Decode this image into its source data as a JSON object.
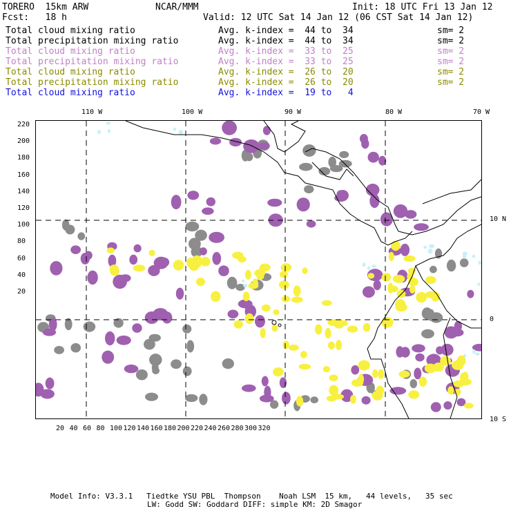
{
  "header": {
    "model": "TORERO  15km ARW",
    "center": "NCAR/MMM",
    "init": "Init: 18 UTC Fri 13 Jan 12",
    "fcst": "Fcst:   18 h",
    "valid": "Valid: 12 UTC Sat 14 Jan 12 (06 CST Sat 14 Jan 12)"
  },
  "fields": [
    {
      "name": "Total cloud mixing ratio",
      "stat": "Avg. k-index =  44 to  34",
      "sm": "sm= 2",
      "color": "#000000"
    },
    {
      "name": "Total precipitation mixing ratio",
      "stat": "Avg. k-index =  44 to  34",
      "sm": "sm= 2",
      "color": "#000000"
    },
    {
      "name": "Total cloud mixing ratio",
      "stat": "Avg. k-index =  33 to  25",
      "sm": "sm= 2",
      "color": "#c080c8"
    },
    {
      "name": "Total precipitation mixing ratio",
      "stat": "Avg. k-index =  33 to  25",
      "sm": "sm= 2",
      "color": "#c080c8"
    },
    {
      "name": "Total cloud mixing ratio",
      "stat": "Avg. k-index =  26 to  20",
      "sm": "sm= 2",
      "color": "#8a8a00"
    },
    {
      "name": "Total precipitation mixing ratio",
      "stat": "Avg. k-index =  26 to  20",
      "sm": "sm= 2",
      "color": "#8a8a00"
    },
    {
      "name": "Total cloud mixing ratio",
      "stat": "Avg. k-index =  19 to   4",
      "sm": "",
      "color": "#1010e0"
    }
  ],
  "map": {
    "top_labels": [
      "110 W",
      "100 W",
      "90 W",
      "80 W",
      "70 W"
    ],
    "right_labels": [
      "10 N",
      "0",
      "10 S"
    ],
    "y_ticks": [
      "220",
      "200",
      "180",
      "160",
      "140",
      "120",
      "100",
      "80",
      "60",
      "40",
      "20"
    ],
    "x_ticks": [
      "20",
      "40",
      "60",
      "80",
      "100",
      "120",
      "140",
      "160",
      "180",
      "200",
      "220",
      "240",
      "260",
      "280",
      "300",
      "320"
    ],
    "colors": {
      "gray": "#8c8c8c",
      "purple": "#a060b0",
      "yellow": "#f8f040",
      "cyan": "#c8f0f8"
    }
  },
  "footer": {
    "line1": "Model Info: V3.3.1   Tiedtke YSU PBL  Thompson    Noah LSM  15 km,   44 levels,   35 sec",
    "line2": "LW: Godd SW: Goddard DIFF: simple KM: 2D Smagor"
  }
}
